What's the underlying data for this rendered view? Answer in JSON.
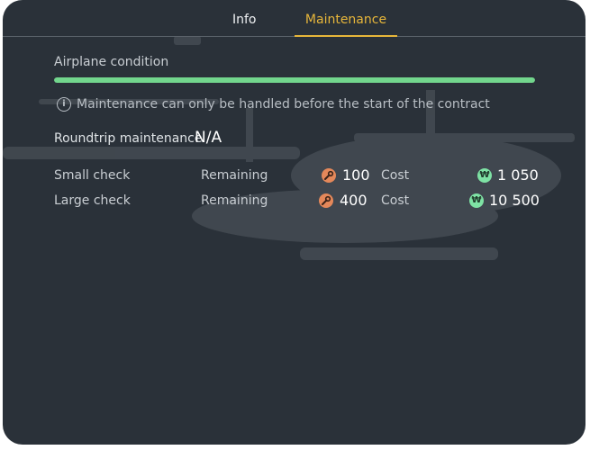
{
  "tabs": [
    {
      "label": "Info",
      "active": false
    },
    {
      "label": "Maintenance",
      "active": true
    }
  ],
  "condition": {
    "label": "Airplane condition",
    "level": 1.0
  },
  "notice": {
    "icon": "info-icon",
    "text": "Maintenance can only be handled before the start of the contract"
  },
  "roundtrip": {
    "label": "Roundtrip maintenance",
    "value": "N/A"
  },
  "checks": [
    {
      "name": "Small check",
      "remaining_label": "Remaining",
      "remaining": "100",
      "cost_label": "Cost",
      "cost": "1 050"
    },
    {
      "name": "Large check",
      "remaining_label": "Remaining",
      "remaining": "400",
      "cost_label": "Cost",
      "cost": "10 500"
    }
  ],
  "colors": {
    "accent": "#e7b63a",
    "condition_bar": "#72d68d",
    "panel": "#2a3139",
    "wrench": "#e4885a",
    "coin": "#7ee2a4"
  }
}
